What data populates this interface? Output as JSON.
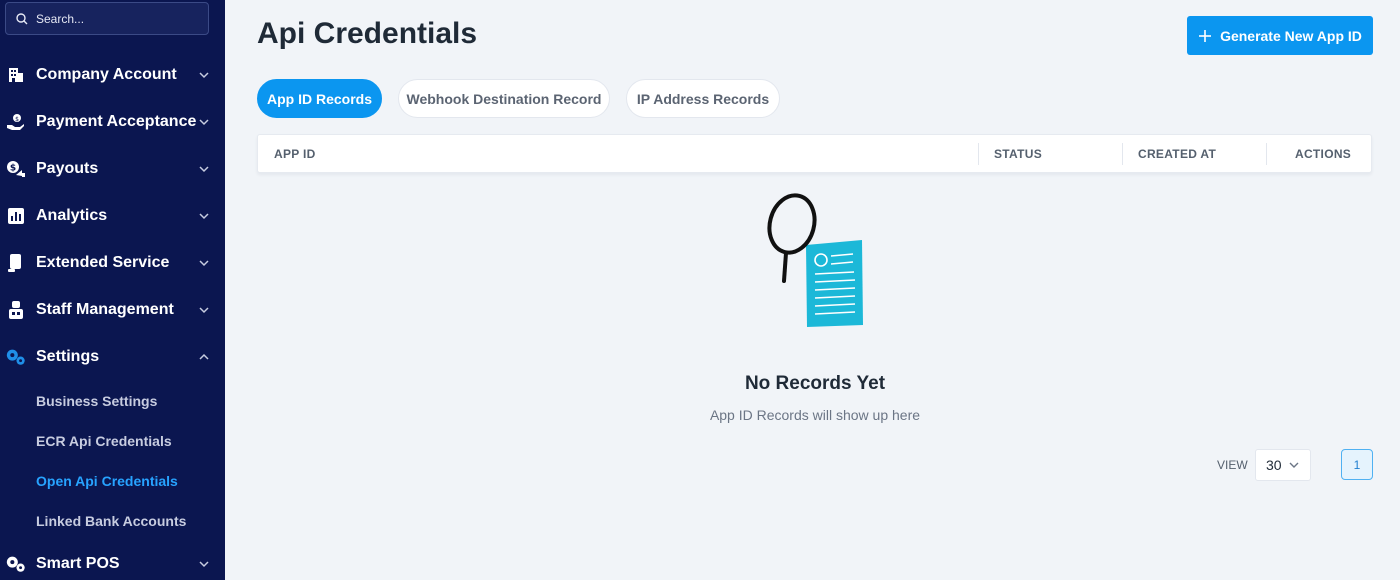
{
  "search": {
    "placeholder": "Search..."
  },
  "sidebar": {
    "items": [
      {
        "label": "Company Account",
        "icon": "building-icon"
      },
      {
        "label": "Payment Acceptance",
        "icon": "hand-coin-icon"
      },
      {
        "label": "Payouts",
        "icon": "dollar-arrow-icon"
      },
      {
        "label": "Analytics",
        "icon": "bar-chart-icon"
      },
      {
        "label": "Extended Service",
        "icon": "device-icon"
      },
      {
        "label": "Staff Management",
        "icon": "staff-icon"
      },
      {
        "label": "Settings",
        "icon": "gears-icon",
        "expanded": true
      },
      {
        "label": "Smart POS",
        "icon": "gears-icon"
      }
    ],
    "settings_sub": [
      {
        "label": "Business Settings"
      },
      {
        "label": "ECR Api Credentials"
      },
      {
        "label": "Open Api Credentials",
        "active": true
      },
      {
        "label": "Linked Bank Accounts"
      }
    ]
  },
  "main": {
    "title": "Api Credentials",
    "generate_button": "Generate New App ID",
    "tabs": [
      {
        "label": "App ID Records",
        "active": true
      },
      {
        "label": "Webhook Destination Record"
      },
      {
        "label": "IP Address Records"
      }
    ],
    "columns": [
      "APP ID",
      "STATUS",
      "CREATED AT",
      "ACTIONS"
    ],
    "empty": {
      "title": "No Records Yet",
      "subtitle": "App ID Records will show up here"
    },
    "pagination": {
      "view_label": "VIEW",
      "page_size": "30",
      "current_page": "1"
    }
  },
  "colors": {
    "sidebar_bg": "#0b1650",
    "accent": "#0b96f0",
    "active_sub_item": "#27a3ff",
    "page_bg": "#f1f4f8"
  }
}
